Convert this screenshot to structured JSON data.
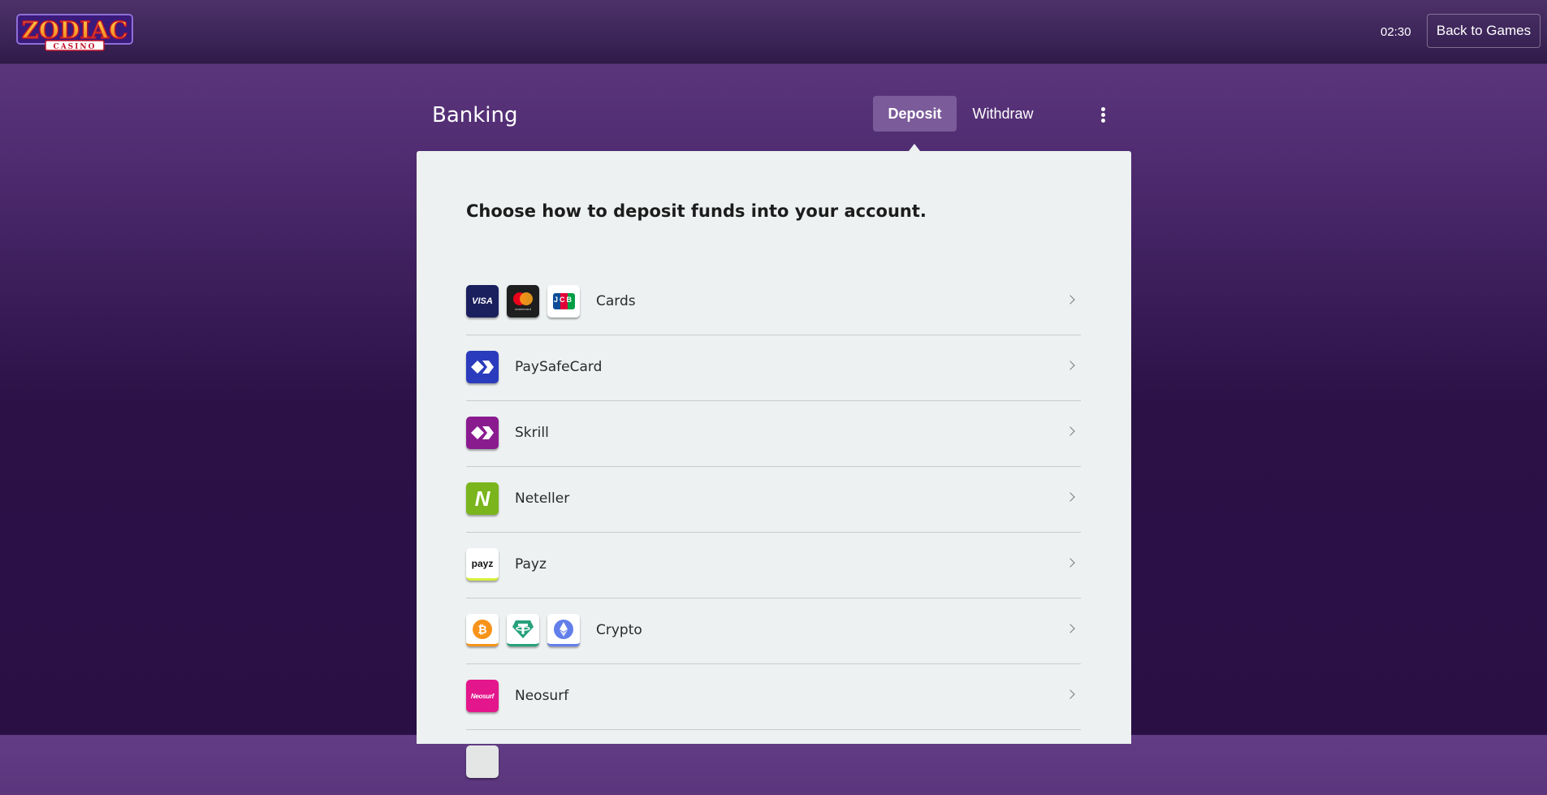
{
  "header": {
    "logo_title": "ZODIAC",
    "logo_subtitle": "CASINO",
    "clock": "02:30",
    "back_button_label": "Back to Games"
  },
  "page": {
    "title": "Banking",
    "tabs": [
      {
        "label": "Deposit",
        "active": true
      },
      {
        "label": "Withdraw",
        "active": false
      }
    ],
    "menu_icon": "more-vertical-icon"
  },
  "panel": {
    "heading": "Choose how to deposit funds into your account.",
    "methods": [
      {
        "label": "Cards",
        "icons": [
          "visa-icon",
          "mastercard-icon",
          "jcb-icon"
        ]
      },
      {
        "label": "PaySafeCard",
        "icons": [
          "paysafecard-icon"
        ]
      },
      {
        "label": "Skrill",
        "icons": [
          "skrill-icon"
        ]
      },
      {
        "label": "Neteller",
        "icons": [
          "neteller-icon"
        ]
      },
      {
        "label": "Payz",
        "icons": [
          "payz-icon"
        ]
      },
      {
        "label": "Crypto",
        "icons": [
          "bitcoin-icon",
          "tether-icon",
          "ethereum-icon"
        ]
      },
      {
        "label": "Neosurf",
        "icons": [
          "neosurf-icon"
        ]
      }
    ],
    "icon_text": {
      "visa": "VISA",
      "mastercard": "mastercard",
      "jcb": "JCB",
      "neteller": "N",
      "payz": "payz",
      "bitcoin": "₿",
      "neosurf": "Neosurf"
    }
  },
  "colors": {
    "accent_tab": "#7b5b99",
    "panel_bg": "#edf1f1",
    "visa_bg": "#1a1f5e",
    "paysafecard_bg": "#2a3bbd",
    "skrill_bg": "#8a1b8f",
    "neteller_bg": "#7ab51d",
    "neosurf_bg": "#e4168c"
  }
}
